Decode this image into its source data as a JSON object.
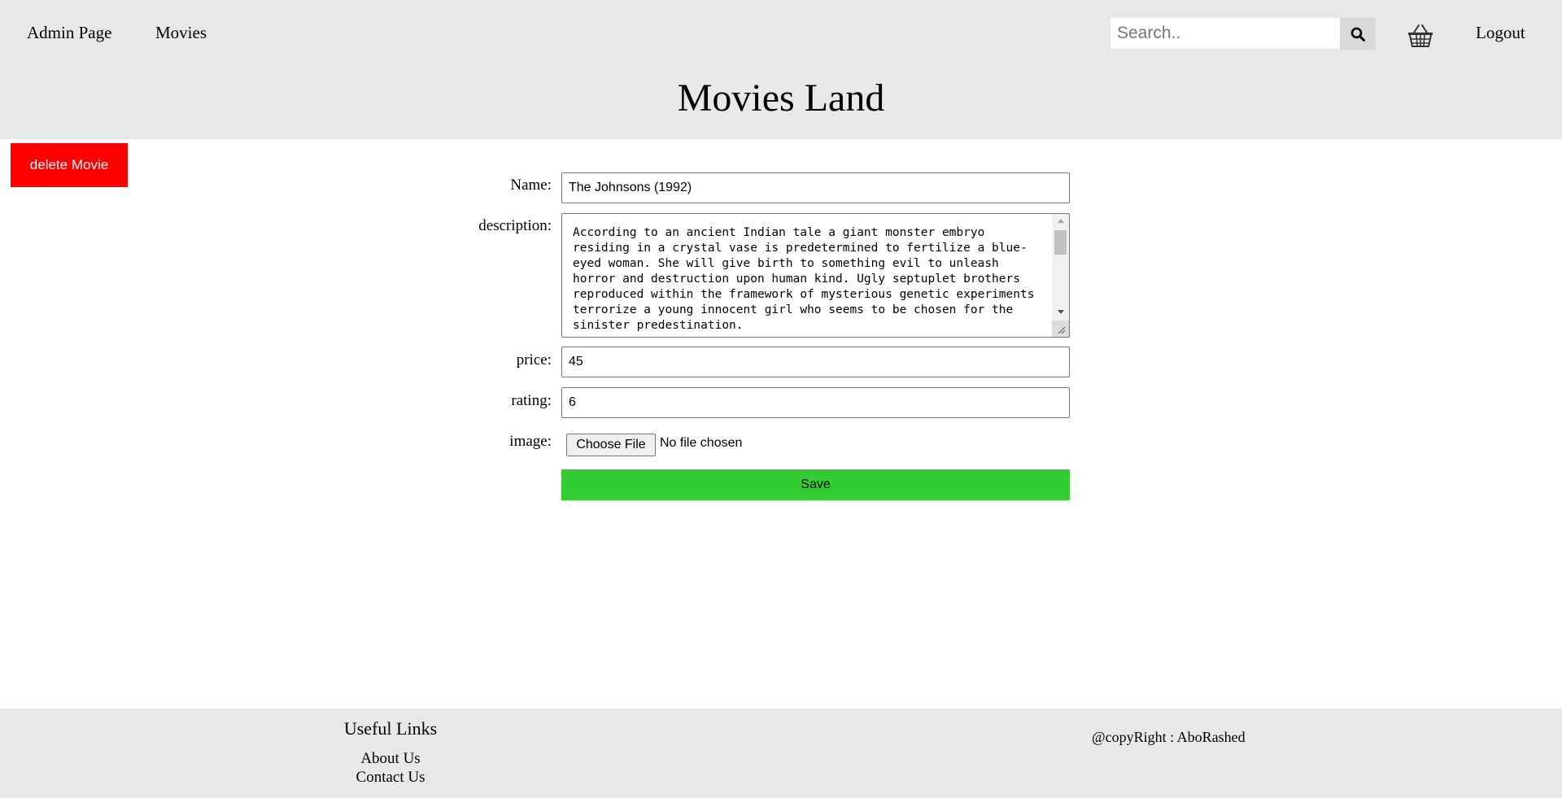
{
  "header": {
    "nav": {
      "admin_label": "Admin Page",
      "movies_label": "Movies",
      "logout_label": "Logout"
    },
    "search": {
      "placeholder": "Search..",
      "icon": "search-icon"
    },
    "cart_icon": "basket-icon",
    "site_title": "Movies Land",
    "background_color": "#e8e8e8"
  },
  "actions": {
    "delete_label": "delete Movie",
    "delete_color": "#ff0000"
  },
  "form": {
    "name": {
      "label": "Name:",
      "value": "The Johnsons (1992)"
    },
    "description": {
      "label": "description:",
      "value": "According to an ancient Indian tale a giant monster embryo residing in a crystal vase is predetermined to fertilize a blue-eyed woman. She will give birth to something evil to unleash horror and destruction upon human kind. Ugly septuplet brothers reproduced within the framework of mysterious genetic experiments terrorize a young innocent girl who seems to be chosen for the sinister predestination."
    },
    "price": {
      "label": "price:",
      "value": "45"
    },
    "rating": {
      "label": "rating:",
      "value": "6"
    },
    "image": {
      "label": "image:",
      "button_label": "Choose File",
      "status": "No file chosen"
    },
    "save_label": "Save",
    "save_color": "#32cd32"
  },
  "footer": {
    "heading": "Useful Links",
    "links": [
      "About Us",
      "Contact Us"
    ],
    "copyright": "@copyRight : AboRashed"
  }
}
